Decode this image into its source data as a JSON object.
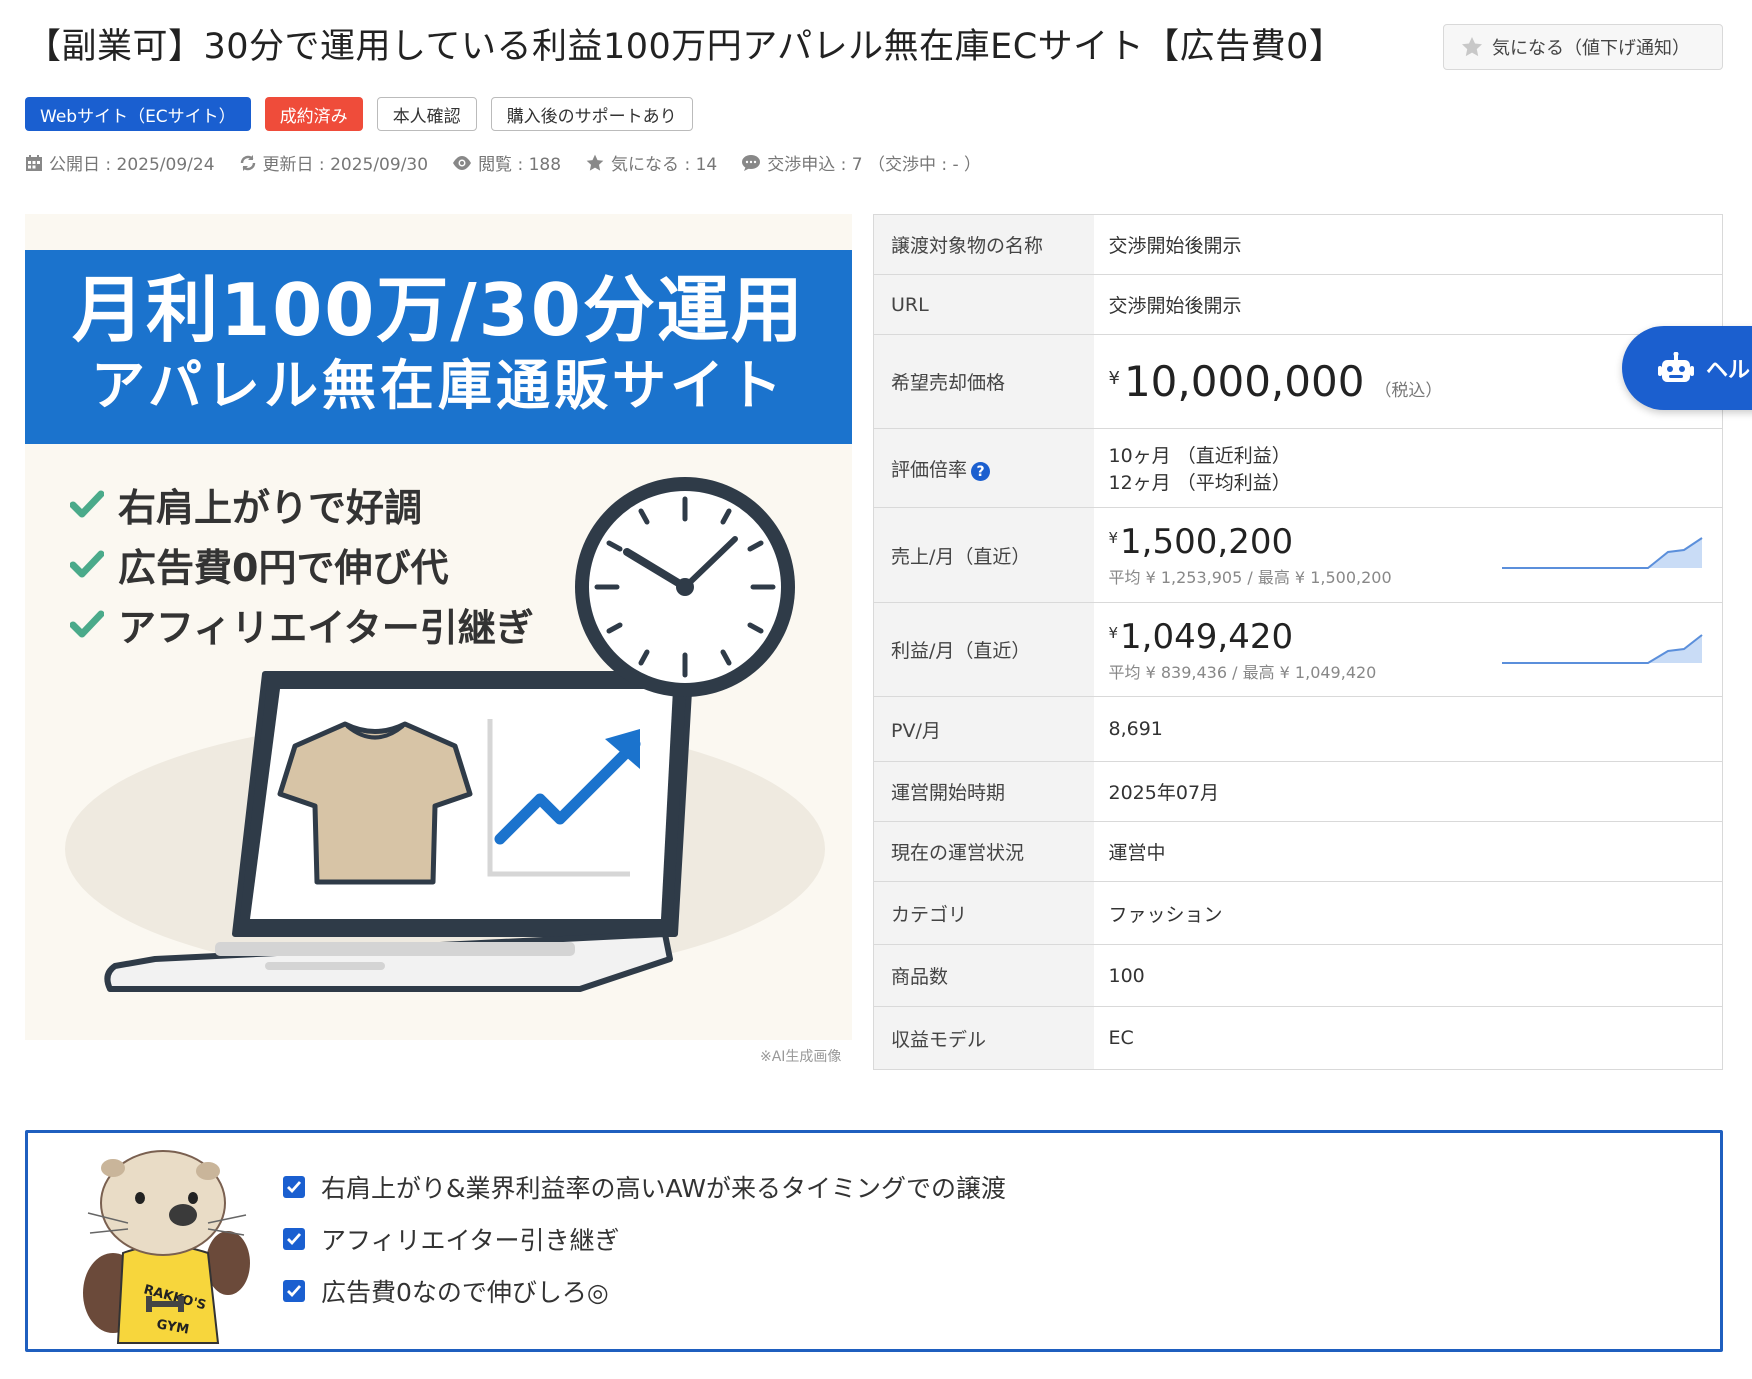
{
  "title": "【副業可】30分で運用している利益100万円アパレル無在庫ECサイト【広告費0】",
  "fav_button": "気になる（値下げ通知）",
  "tags": [
    "Webサイト（ECサイト）",
    "成約済み",
    "本人確認",
    "購入後のサポートあり"
  ],
  "meta": {
    "published": "公開日 : 2025/09/24",
    "updated": "更新日 : 2025/09/30",
    "views": "閲覧 : 188",
    "favorites": "気になる : 14",
    "offers": "交渉申込 : 7 （交渉中 : - ）"
  },
  "hero": {
    "line1": "月利100万/30分運用",
    "line2": "アパレル無在庫通販サイト",
    "checks": [
      "右肩上がりで好調",
      "広告費0円で伸び代",
      "アフィリエイター引継ぎ"
    ],
    "note": "※AI生成画像"
  },
  "spec": {
    "name_label": "譲渡対象物の名称",
    "name_value": "交渉開始後開示",
    "url_label": "URL",
    "url_value": "交渉開始後開示",
    "price_label": "希望売却価格",
    "price_yen": "¥",
    "price_value": "10,000,000",
    "price_tax": "（税込）",
    "multiple_label": "評価倍率",
    "multiple_q": "?",
    "multiple_recent": "10ヶ月 （直近利益）",
    "multiple_avg": "12ヶ月 （平均利益）",
    "sales_label": "売上/月（直近）",
    "sales_yen": "¥",
    "sales_value": "1,500,200",
    "sales_sub": "平均 ¥ 1,253,905 / 最高 ¥ 1,500,200",
    "profit_label": "利益/月（直近）",
    "profit_yen": "¥",
    "profit_value": "1,049,420",
    "profit_sub": "平均 ¥ 839,436 / 最高 ¥ 1,049,420",
    "pv_label": "PV/月",
    "pv_value": "8,691",
    "start_label": "運営開始時期",
    "start_value": "2025年07月",
    "status_label": "現在の運営状況",
    "status_value": "運営中",
    "category_label": "カテゴリ",
    "category_value": "ファッション",
    "items_label": "商品数",
    "items_value": "100",
    "model_label": "収益モデル",
    "model_value": "EC"
  },
  "help_button": "ヘルプ",
  "points": [
    "右肩上がり&業界利益率の高いAWが来るタイミングでの譲渡",
    "アフィリエイター引き継ぎ",
    "広告費0なので伸びしろ◎"
  ],
  "mascot_text": [
    "RAKKO'S",
    "GYM"
  ],
  "colors": {
    "primary": "#1a5fd0",
    "sold": "#ef4c3a",
    "banner": "#1b73cd",
    "check_green": "#4aaa8a"
  }
}
